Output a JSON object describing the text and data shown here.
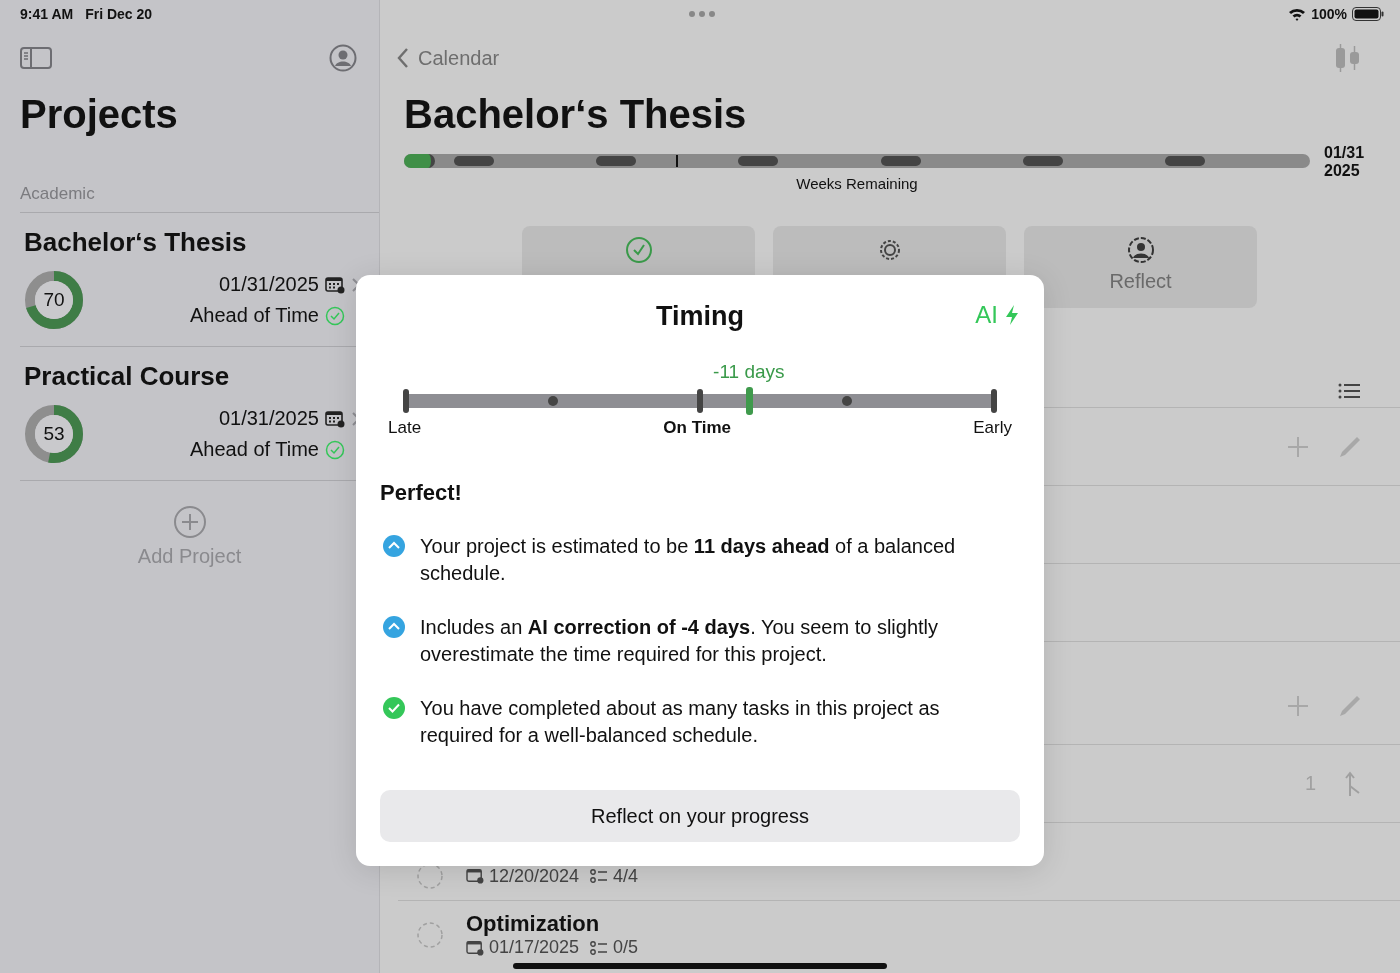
{
  "status_bar": {
    "time": "9:41 AM",
    "date": "Fri Dec 20",
    "battery": "100%"
  },
  "sidebar": {
    "title": "Projects",
    "section": "Academic",
    "projects": [
      {
        "name": "Bachelor‘s Thesis",
        "progress": "70",
        "level": 0.7,
        "due": "01/31/2025",
        "status": "Ahead of Time"
      },
      {
        "name": "Practical Course",
        "progress": "53",
        "level": 0.53,
        "due": "01/31/2025",
        "status": "Ahead of Time"
      }
    ],
    "add_label": "Add Project"
  },
  "detail": {
    "back": "Calendar",
    "title": "Bachelor‘s Thesis",
    "timeline": {
      "level": 0.03,
      "caption": "Weeks Remaining",
      "end_date": "01/31",
      "end_year": "2025"
    },
    "actions": [
      {
        "kind": "check"
      },
      {
        "kind": "gear"
      },
      {
        "kind": "reflect",
        "label": "Reflect"
      }
    ],
    "rows": [
      {
        "kind": "edit"
      },
      {
        "kind": "blank"
      },
      {
        "kind": "blank"
      },
      {
        "kind": "edit_tall"
      },
      {
        "kind": "merge",
        "count": "1"
      },
      {
        "kind": "task",
        "done": false,
        "date": "12/20/2024",
        "tasks": "4/4"
      },
      {
        "kind": "task",
        "done": false,
        "title": "Optimization",
        "date": "01/17/2025",
        "tasks": "0/5"
      }
    ]
  },
  "modal": {
    "title": "Timing",
    "badge": "AI",
    "scale": {
      "value_label": "-11 days",
      "level": 0.583,
      "labels": [
        "Late",
        "On Time",
        "Early"
      ]
    },
    "heading": "Perfect!",
    "points": [
      {
        "kind": "up",
        "text": "Your project is estimated to be **11 days ahead** of a balanced schedule."
      },
      {
        "kind": "up",
        "text": "Includes an **AI correction of -4 days**. You seem to slightly overestimate the time required for this project."
      },
      {
        "kind": "check",
        "text": "You have completed about as many tasks in this project as required for a well-balanced schedule."
      }
    ],
    "button": "Reflect on your progress"
  }
}
